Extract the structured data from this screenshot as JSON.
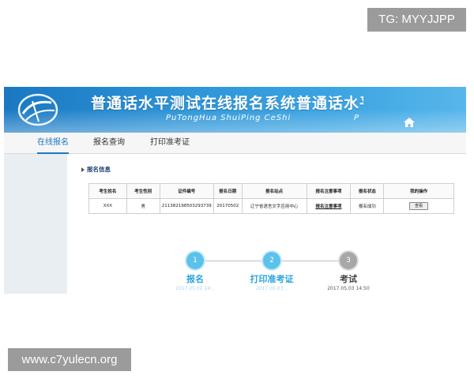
{
  "watermarks": {
    "top_right": "TG: MYYJJPP",
    "bottom_left": "www.c7yulecn.org"
  },
  "banner": {
    "title": "普通话水平测试在线报名系统普通话水平测",
    "subtitle": "PuTongHua ShuiPing CeShi",
    "subtitle_trail": "P"
  },
  "nav": {
    "items": [
      {
        "label": "在线报名",
        "active": true
      },
      {
        "label": "报名查询",
        "active": false
      },
      {
        "label": "打印准考证",
        "active": false
      }
    ]
  },
  "section": {
    "title": "报名信息"
  },
  "table": {
    "headers": [
      "考生姓名",
      "考生性别",
      "证件编号",
      "报名日期",
      "报名站点",
      "报名注意事项",
      "报名状态",
      "我的操作"
    ],
    "rows": [
      {
        "name": "XXX",
        "gender": "男",
        "id_number": "211382198503293739",
        "date": "20170502",
        "site": "辽宁省语言文字应用中心",
        "notice": "报名注意事项",
        "status": "报名成功",
        "action": "查看"
      }
    ]
  },
  "steps": [
    {
      "number": "1",
      "label": "报名",
      "date": "2017.05.02 14:..",
      "state": "done"
    },
    {
      "number": "2",
      "label": "打印准考证",
      "date": "2017.05.03 ..",
      "state": "done"
    },
    {
      "number": "3",
      "label": "考试",
      "date": "2017.05.03 14:50",
      "state": "todo"
    }
  ],
  "colors": {
    "accent": "#1a78c2",
    "step_done": "#5bc2ea",
    "step_todo": "#a7a7a7"
  }
}
